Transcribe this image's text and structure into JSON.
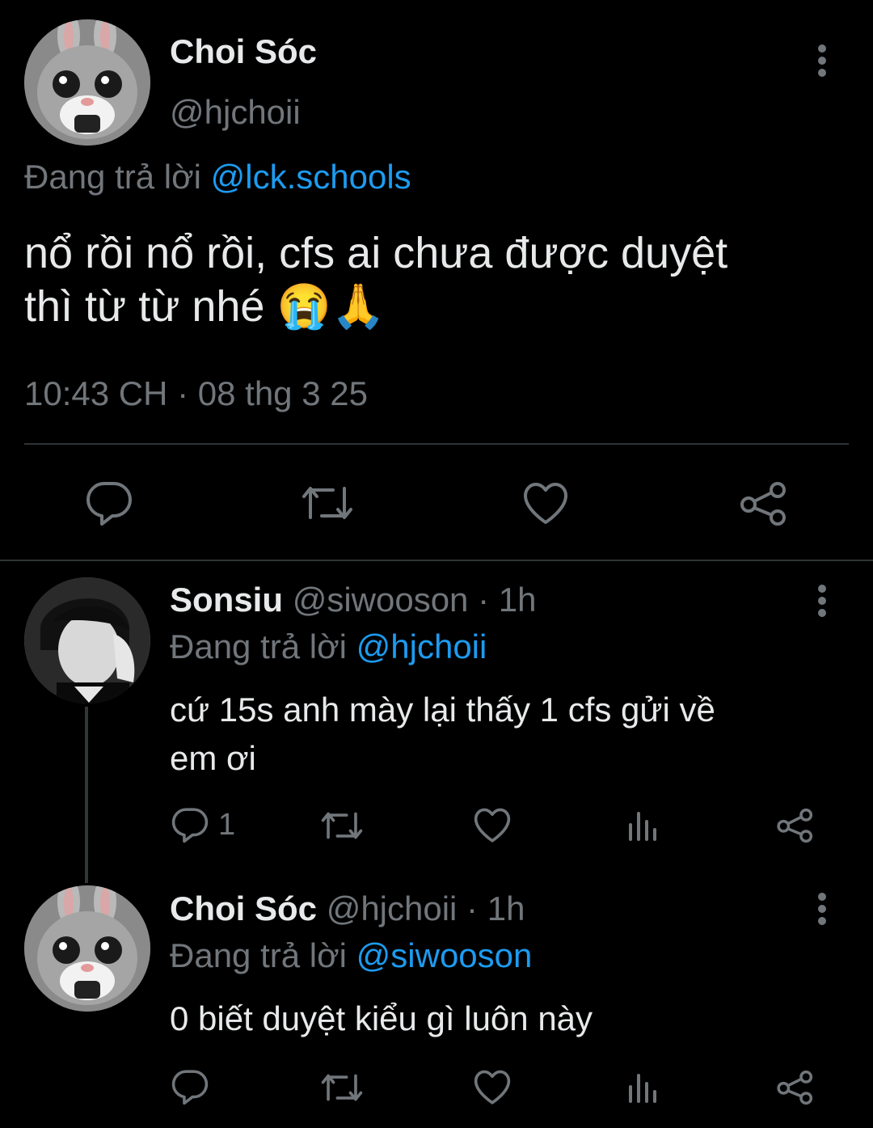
{
  "main_tweet": {
    "author_name": "Choi Sóc",
    "handle": "@hjchoii",
    "replying_prefix": "Đang trả lời",
    "replying_to": "@lck.schools",
    "text_line1": "nổ rồi nổ rồi, cfs ai chưa được duyệt",
    "text_line2": "thì từ từ nhé",
    "emojis": "😭🙏",
    "timestamp": "10:43 CH · 08 thg 3 25"
  },
  "replies": [
    {
      "author_name": "Sonsiu",
      "handle_time": "@siwooson · 1h",
      "replying_prefix": "Đang trả lời",
      "replying_to": "@hjchoii",
      "text_line1": "cứ 15s anh mày lại thấy 1 cfs gửi về",
      "text_line2": "em ơi",
      "reply_count": "1"
    },
    {
      "author_name": "Choi Sóc",
      "handle_time": "@hjchoii · 1h",
      "replying_prefix": "Đang trả lời",
      "replying_to": "@siwooson",
      "text_line1": "0 biết duyệt kiểu gì luôn này",
      "reply_count": ""
    }
  ],
  "colors": {
    "background": "#000000",
    "text": "#e7e9ea",
    "muted": "#71767b",
    "link": "#1d9bf0",
    "divider": "#2f3336"
  },
  "icons": [
    "more-vertical-icon",
    "reply-icon",
    "retweet-icon",
    "like-icon",
    "views-icon",
    "share-icon"
  ]
}
